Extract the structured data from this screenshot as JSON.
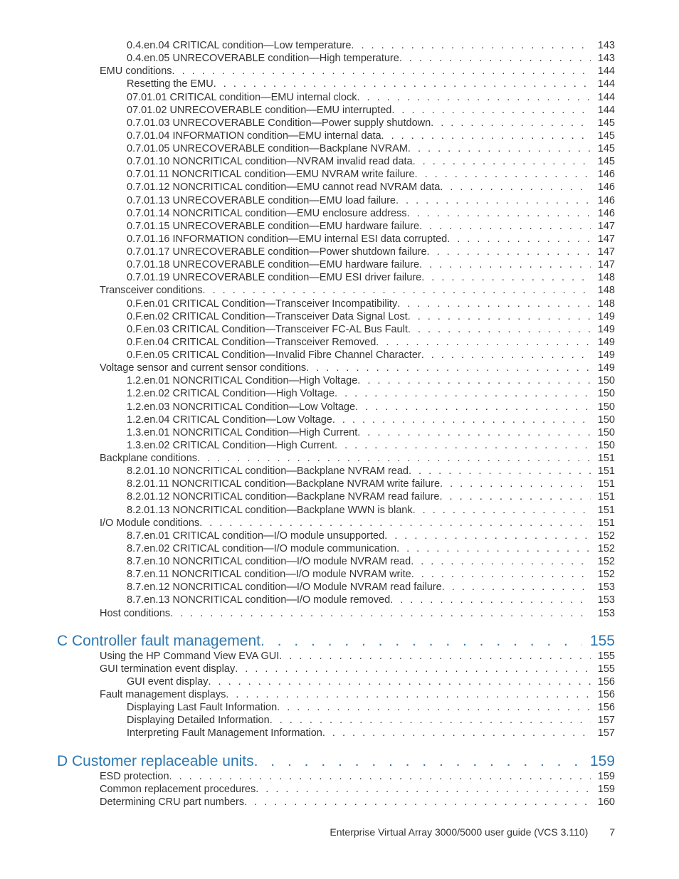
{
  "entries": [
    {
      "lvl": 2,
      "t": "0.4.en.04 CRITICAL condition—Low temperature",
      "p": "143"
    },
    {
      "lvl": 2,
      "t": "0.4.en.05 UNRECOVERABLE condition—High temperature",
      "p": "143"
    },
    {
      "lvl": 1,
      "t": "EMU conditions",
      "p": "144"
    },
    {
      "lvl": 2,
      "t": "Resetting the EMU",
      "p": "144"
    },
    {
      "lvl": 2,
      "t": "07.01.01 CRITICAL condition—EMU internal clock",
      "p": "144"
    },
    {
      "lvl": 2,
      "t": "07.01.02 UNRECOVERABLE condition—EMU interrupted",
      "p": "144"
    },
    {
      "lvl": 2,
      "t": "0.7.01.03 UNRECOVERABLE Condition—Power supply shutdown",
      "p": "145"
    },
    {
      "lvl": 2,
      "t": "0.7.01.04 INFORMATION condition—EMU internal data",
      "p": "145"
    },
    {
      "lvl": 2,
      "t": "0.7.01.05 UNRECOVERABLE condition—Backplane NVRAM",
      "p": "145"
    },
    {
      "lvl": 2,
      "t": "0.7.01.10 NONCRITICAL condition—NVRAM invalid read data",
      "p": "145"
    },
    {
      "lvl": 2,
      "t": "0.7.01.11 NONCRITICAL condition—EMU NVRAM write failure",
      "p": "146"
    },
    {
      "lvl": 2,
      "t": "0.7.01.12 NONCRITICAL condition—EMU cannot read NVRAM data",
      "p": "146"
    },
    {
      "lvl": 2,
      "t": "0.7.01.13 UNRECOVERABLE condition—EMU load failure",
      "p": "146"
    },
    {
      "lvl": 2,
      "t": "0.7.01.14 NONCRITICAL condition—EMU enclosure address",
      "p": "146"
    },
    {
      "lvl": 2,
      "t": "0.7.01.15 UNRECOVERABLE condition—EMU hardware failure",
      "p": "147"
    },
    {
      "lvl": 2,
      "t": "0.7.01.16 INFORMATION condition—EMU internal ESI data corrupted",
      "p": "147"
    },
    {
      "lvl": 2,
      "t": "0.7.01.17 UNRECOVERABLE condition—Power shutdown failure",
      "p": "147"
    },
    {
      "lvl": 2,
      "t": "0.7.01.18 UNRECOVERABLE condition—EMU hardware failure",
      "p": "147"
    },
    {
      "lvl": 2,
      "t": "0.7.01.19 UNRECOVERABLE condition—EMU ESI driver failure",
      "p": "148"
    },
    {
      "lvl": 1,
      "t": "Transceiver conditions",
      "p": "148"
    },
    {
      "lvl": 2,
      "t": "0.F.en.01 CRITICAL Condition—Transceiver Incompatibility",
      "p": "148"
    },
    {
      "lvl": 2,
      "t": "0.F.en.02 CRITICAL Condition—Transceiver Data Signal Lost",
      "p": "149"
    },
    {
      "lvl": 2,
      "t": "0.F.en.03 CRITICAL Condition—Transceiver FC-AL Bus Fault",
      "p": "149"
    },
    {
      "lvl": 2,
      "t": "0.F.en.04 CRITICAL Condition—Transceiver Removed",
      "p": "149"
    },
    {
      "lvl": 2,
      "t": "0.F.en.05 CRITICAL Condition—Invalid Fibre Channel Character",
      "p": "149"
    },
    {
      "lvl": 1,
      "t": "Voltage sensor and current sensor conditions",
      "p": "149"
    },
    {
      "lvl": 2,
      "t": "1.2.en.01 NONCRITICAL Condition—High Voltage",
      "p": "150"
    },
    {
      "lvl": 2,
      "t": "1.2.en.02 CRITICAL Condition—High Voltage",
      "p": "150"
    },
    {
      "lvl": 2,
      "t": "1.2.en.03 NONCRITICAL Condition—Low Voltage",
      "p": "150"
    },
    {
      "lvl": 2,
      "t": "1.2.en.04 CRITICAL Condition—Low Voltage",
      "p": "150"
    },
    {
      "lvl": 2,
      "t": "1.3.en.01 NONCRITICAL Condition—High Current",
      "p": "150"
    },
    {
      "lvl": 2,
      "t": "1.3.en.02 CRITICAL Condition—High Current",
      "p": "150"
    },
    {
      "lvl": 1,
      "t": "Backplane conditions",
      "p": "151"
    },
    {
      "lvl": 2,
      "t": "8.2.01.10 NONCRITICAL condition—Backplane NVRAM read",
      "p": "151"
    },
    {
      "lvl": 2,
      "t": "8.2.01.11 NONCRITICAL condition—Backplane NVRAM write failure",
      "p": "151"
    },
    {
      "lvl": 2,
      "t": "8.2.01.12 NONCRITICAL condition—Backplane NVRAM read failure",
      "p": "151"
    },
    {
      "lvl": 2,
      "t": "8.2.01.13 NONCRITICAL condition—Backplane WWN is blank",
      "p": "151"
    },
    {
      "lvl": 1,
      "t": "I/O Module conditions",
      "p": "151"
    },
    {
      "lvl": 2,
      "t": "8.7.en.01 CRITICAL condition—I/O module unsupported",
      "p": "152"
    },
    {
      "lvl": 2,
      "t": "8.7.en.02 CRITICAL condition—I/O module communication",
      "p": "152"
    },
    {
      "lvl": 2,
      "t": "8.7.en.10 NONCRITICAL condition—I/O module NVRAM read",
      "p": "152"
    },
    {
      "lvl": 2,
      "t": "8.7.en.11 NONCRITICAL condition—I/O module NVRAM write",
      "p": "152"
    },
    {
      "lvl": 2,
      "t": "8.7.en.12 NONCRITICAL condition—I/O Module NVRAM read failure",
      "p": "153"
    },
    {
      "lvl": 2,
      "t": "8.7.en.13 NONCRITICAL condition—I/O module removed",
      "p": "153"
    },
    {
      "lvl": 1,
      "t": "Host conditions",
      "p": "153"
    }
  ],
  "sectionC": {
    "title": "C Controller fault management",
    "page": "155"
  },
  "cEntries": [
    {
      "lvl": 1,
      "t": "Using the HP Command View EVA GUI",
      "p": "155"
    },
    {
      "lvl": 1,
      "t": "GUI termination event display",
      "p": "155"
    },
    {
      "lvl": 2,
      "t": "GUI event display",
      "p": "156"
    },
    {
      "lvl": 1,
      "t": "Fault management displays",
      "p": "156"
    },
    {
      "lvl": 2,
      "t": "Displaying Last Fault Information",
      "p": "156"
    },
    {
      "lvl": 2,
      "t": "Displaying Detailed Information",
      "p": "157"
    },
    {
      "lvl": 2,
      "t": "Interpreting Fault Management Information",
      "p": "157"
    }
  ],
  "sectionD": {
    "title": "D Customer replaceable units",
    "page": "159"
  },
  "dEntries": [
    {
      "lvl": 1,
      "t": "ESD protection",
      "p": "159"
    },
    {
      "lvl": 1,
      "t": "Common replacement procedures",
      "p": "159"
    },
    {
      "lvl": 1,
      "t": "Determining CRU part numbers",
      "p": "160"
    }
  ],
  "footer": {
    "text": "Enterprise Virtual Array 3000/5000 user guide (VCS 3.110)",
    "page": "7"
  }
}
